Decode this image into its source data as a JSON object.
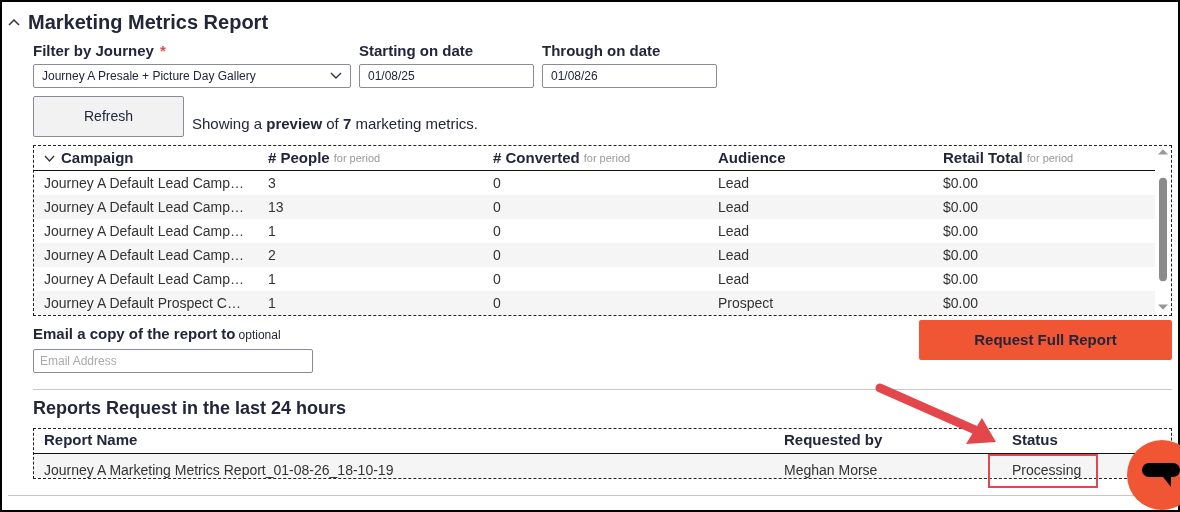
{
  "section": {
    "title": "Marketing Metrics Report",
    "expanded": true
  },
  "filters": [
    {
      "kind": "select",
      "label": "Filter by Journey",
      "required_mark": "*",
      "value": "Journey A Presale + Picture Day Gallery"
    },
    {
      "kind": "text",
      "label": "Starting on date",
      "value": "01/08/25"
    },
    {
      "kind": "text",
      "label": "Through on date",
      "value": "01/08/26"
    }
  ],
  "refresh_button": "Refresh",
  "preview_text": "Showing a **preview** of **7** marketing metrics.",
  "metrics_table": {
    "columns": [
      {
        "label": "Campaign"
      },
      {
        "label": "# People",
        "note": "for period"
      },
      {
        "label": "# Converted",
        "note": "for period"
      },
      {
        "label": "Audience"
      },
      {
        "label": "Retail Total",
        "note": "for period"
      }
    ],
    "rows": [
      [
        "Journey A Default Lead Camp…",
        "3",
        "0",
        "Lead",
        "$0.00"
      ],
      [
        "Journey A Default Lead Camp…",
        "13",
        "0",
        "Lead",
        "$0.00"
      ],
      [
        "Journey A Default Lead Camp…",
        "1",
        "0",
        "Lead",
        "$0.00"
      ],
      [
        "Journey A Default Lead Camp…",
        "2",
        "0",
        "Lead",
        "$0.00"
      ],
      [
        "Journey A Default Lead Camp…",
        "1",
        "0",
        "Lead",
        "$0.00"
      ],
      [
        "Journey A Default Prospect C…",
        "1",
        "0",
        "Prospect",
        "$0.00"
      ]
    ]
  },
  "email": {
    "label": "Email a copy of the report to",
    "note": "optional",
    "placeholder": "Email Address"
  },
  "request_button": "Request Full Report",
  "requests": {
    "title": "Reports Request in the last 24 hours",
    "columns": [
      "Report Name",
      "Requested by",
      "Status"
    ],
    "rows": [
      {
        "cells": [
          "Journey A Marketing Metrics Report_01-08-26_18-10-19",
          "Meghan Morse",
          "Processing"
        ],
        "highlighted": true
      }
    ]
  }
}
